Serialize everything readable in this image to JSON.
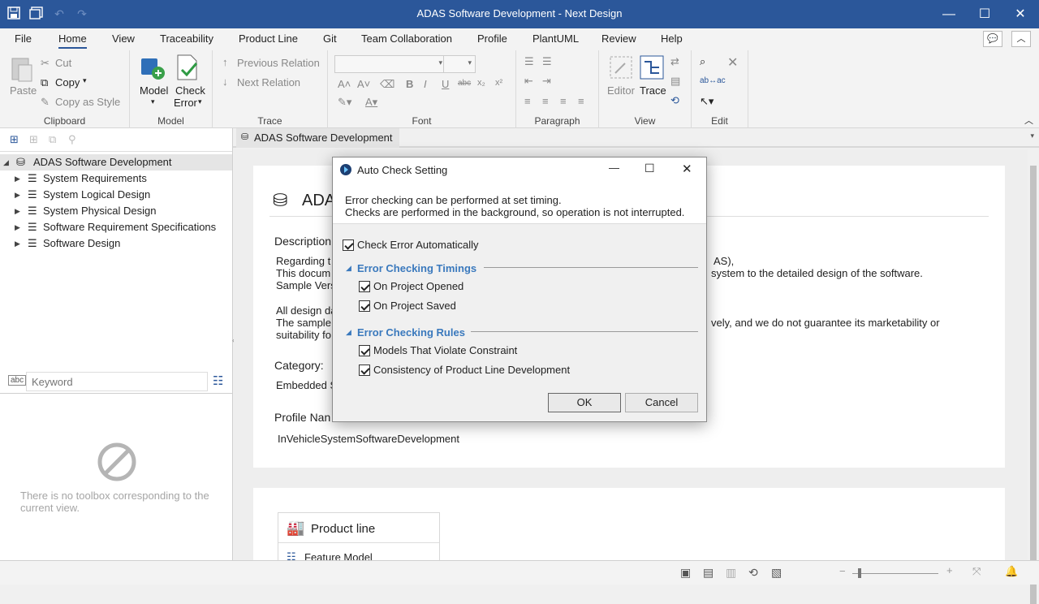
{
  "app": {
    "title": "ADAS Software Development - Next Design"
  },
  "menu": [
    "File",
    "Home",
    "View",
    "Traceability",
    "Product Line",
    "Git",
    "Team Collaboration",
    "Profile",
    "PlantUML",
    "Review",
    "Help"
  ],
  "ribbon": {
    "clipboard": {
      "paste": "Paste",
      "cut": "Cut",
      "copy": "Copy",
      "copy_as_style": "Copy as Style",
      "group": "Clipboard"
    },
    "model": {
      "model": "Model",
      "check": "Check",
      "error": "Error",
      "group": "Model"
    },
    "trace": {
      "previous": "Previous Relation",
      "next": "Next Relation",
      "group": "Trace"
    },
    "font": {
      "group": "Font"
    },
    "paragraph": {
      "group": "Paragraph"
    },
    "view": {
      "editor": "Editor",
      "trace": "Trace",
      "group": "View"
    },
    "edit": {
      "group": "Edit"
    }
  },
  "tree": {
    "root": "ADAS Software Development",
    "items": [
      "System Requirements",
      "System Logical Design",
      "System Physical Design",
      "Software Requirement Specifications",
      "Software Design"
    ]
  },
  "search": {
    "placeholder": "Keyword"
  },
  "toolbox": {
    "empty_message": "There is no toolbox corresponding to the current view."
  },
  "doc": {
    "tab": "ADAS Software Development",
    "title": "ADA",
    "description_label": "Description",
    "desc_lines": [
      "Regarding t",
      "This docum",
      "Sample Vers"
    ],
    "desc_right": [
      "AS),",
      "system to the detailed design of the software."
    ],
    "all_design": "All design da",
    "the_sample": "The sample",
    "suitability": "suitability fo",
    "disclaimer_right": "vely, and we do not guarantee its marketability or",
    "category_label": "Category:",
    "category_value": "Embedded S",
    "profile_label": "Profile Nan",
    "profile_value": "InVehicleSystemSoftwareDevelopment",
    "product_line_title": "Product line",
    "feature_model": "Feature Model"
  },
  "dialog": {
    "title": "Auto Check Setting",
    "line1": "Error checking can be performed at set timing.",
    "line2": "Checks are performed in the background, so operation is not interrupted.",
    "auto": {
      "label": "Check Error Automatically",
      "checked": true
    },
    "timings": {
      "title": "Error Checking Timings",
      "items": [
        {
          "label": "On Project Opened",
          "checked": true
        },
        {
          "label": "On Project Saved",
          "checked": true
        }
      ]
    },
    "rules": {
      "title": "Error Checking Rules",
      "items": [
        {
          "label": "Models That Violate Constraint",
          "checked": true
        },
        {
          "label": "Consistency of Product Line Development",
          "checked": true
        }
      ]
    },
    "ok": "OK",
    "cancel": "Cancel"
  },
  "colors": {
    "titlebar": "#2b579a",
    "accent": "#3a79bd"
  }
}
